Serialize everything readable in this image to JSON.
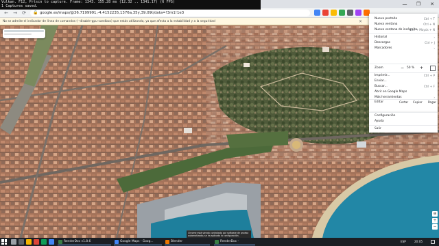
{
  "overlay": {
    "line1": "Vulkan. F12, Prtscn to capture. Frame: 1343. 155.28 ms (12.32 .. 1341.17) (6 FPS)",
    "line2": "1 Captures saved."
  },
  "browser": {
    "url": "google.es/maps/@36.7199991,-4.4152235,1376a,35y,39.09t/data=!3m1!1e3",
    "infobar_text": "No se admite el indicador de línea de comandos (--disable-gpu-sandbox) que estás utilizando, ya que afecta a la estabilidad y a la seguridad",
    "infobar_close": "×",
    "back": "←",
    "forward": "→",
    "reload": "⟳",
    "minimize": "—",
    "maximize": "❐",
    "close": "✕",
    "extension_colors": [
      "#4285f4",
      "#ea4335",
      "#fbbc05",
      "#34a853",
      "#5f6368",
      "#a142f4",
      "#ff6d00"
    ]
  },
  "menu": {
    "items_top": [
      {
        "label": "Nueva pestaña",
        "shortcut": "Ctrl + T"
      },
      {
        "label": "Nueva ventana",
        "shortcut": "Ctrl + N"
      },
      {
        "label": "Nueva ventana de incógnito",
        "shortcut": "Ctrl + Mayús + N"
      }
    ],
    "items_history": [
      {
        "label": "Historial",
        "shortcut": ""
      },
      {
        "label": "Descargas",
        "shortcut": "Ctrl + J"
      },
      {
        "label": "Marcadores",
        "shortcut": ""
      }
    ],
    "zoom": {
      "label": "Zoom",
      "minus": "−",
      "value": "50 %",
      "plus": "+"
    },
    "items_tools": [
      {
        "label": "Imprimir...",
        "shortcut": "Ctrl + P"
      },
      {
        "label": "Enviar...",
        "shortcut": ""
      },
      {
        "label": "Buscar...",
        "shortcut": "Ctrl + F"
      },
      {
        "label": "Abrir en Google Maps",
        "shortcut": ""
      },
      {
        "label": "Más herramientas",
        "shortcut": ""
      }
    ],
    "edit": {
      "label": "Editar",
      "cut": "Cortar",
      "copy": "Copiar",
      "paste": "Pegar"
    },
    "items_settings": [
      {
        "label": "Configuración",
        "shortcut": ""
      },
      {
        "label": "Ayuda",
        "shortcut": ""
      }
    ],
    "exit": "Salir"
  },
  "toast": {
    "text": "Chrome está siendo controlado por software de prueba automatizado; se ha aplicado la configuración."
  },
  "taskbar": {
    "apps": [
      {
        "label": "RenderDoc v1.8.6",
        "color": "#3a7d44"
      },
      {
        "label": "Google Maps - Goog...",
        "color": "#4285f4"
      },
      {
        "label": "Blender",
        "color": "#ea7600"
      },
      {
        "label": "RenderDoc -",
        "color": "#3a7d44"
      }
    ],
    "tray": {
      "lang": "ESP",
      "time": "20:05"
    },
    "icon_colors": [
      "#9aa0a6",
      "#5f6368",
      "#f4b400",
      "#db4437",
      "#0f9d58",
      "#4285f4"
    ]
  }
}
